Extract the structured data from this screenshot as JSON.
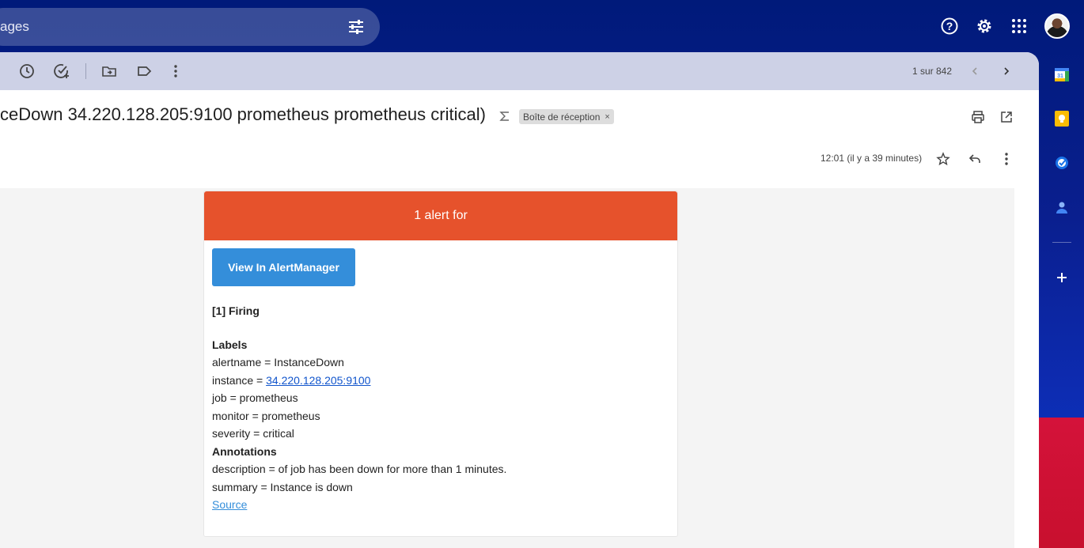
{
  "search": {
    "text": "ages"
  },
  "toolbar": {
    "pager": "1 sur 842"
  },
  "email": {
    "subject": "ceDown 34.220.128.205:9100 prometheus prometheus critical)",
    "label": "Boîte de réception",
    "label_close": "×",
    "date": "12:01 (il y a 39 minutes)"
  },
  "alert": {
    "header": "1 alert for",
    "button": "View In AlertManager",
    "firing": "[1] Firing",
    "labels_title": "Labels",
    "alertname": "alertname = InstanceDown",
    "instance_prefix": "instance = ",
    "instance_link": "34.220.128.205:9100",
    "job": "job = prometheus",
    "monitor": "monitor = prometheus",
    "severity": "severity = critical",
    "annotations_title": "Annotations",
    "description": "description = of job has been down for more than 1 minutes.",
    "summary": "summary = Instance is down",
    "source": "Source"
  },
  "colors": {
    "accent_red": "#e6522c",
    "button_blue": "#348eda",
    "topbar": "#001a7a"
  },
  "icons": [
    "tune-icon",
    "help-icon",
    "gear-icon",
    "apps-icon",
    "snooze-icon",
    "add-task-icon",
    "move-to-icon",
    "label-icon",
    "more-icon",
    "print-icon",
    "open-new-icon",
    "star-icon",
    "reply-icon",
    "calendar-icon",
    "keep-icon",
    "tasks-icon",
    "contacts-icon",
    "plus-icon"
  ]
}
